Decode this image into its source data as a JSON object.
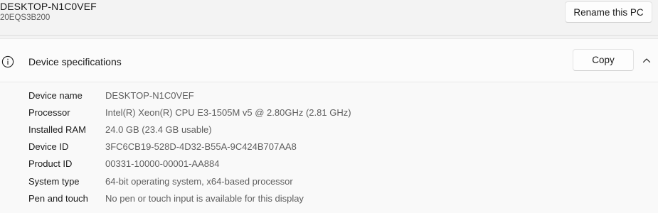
{
  "header": {
    "device_name": "DESKTOP-N1C0VEF",
    "model": "20EQS3B200",
    "rename_label": "Rename this PC"
  },
  "device_specs": {
    "title": "Device specifications",
    "copy_label": "Copy",
    "expanded": true,
    "rows": [
      {
        "label": "Device name",
        "value": "DESKTOP-N1C0VEF"
      },
      {
        "label": "Processor",
        "value": "Intel(R) Xeon(R) CPU E3-1505M v5 @ 2.80GHz (2.81 GHz)"
      },
      {
        "label": "Installed RAM",
        "value": "24.0 GB (23.4 GB usable)"
      },
      {
        "label": "Device ID",
        "value": "3FC6CB19-528D-4D32-B55A-9C424B707AA8"
      },
      {
        "label": "Product ID",
        "value": "00331-10000-00001-AA884"
      },
      {
        "label": "System type",
        "value": "64-bit operating system, x64-based processor"
      },
      {
        "label": "Pen and touch",
        "value": "No pen or touch input is available for this display"
      }
    ]
  },
  "icons": {
    "info": "info-icon",
    "collapse": "chevron-up-icon"
  }
}
